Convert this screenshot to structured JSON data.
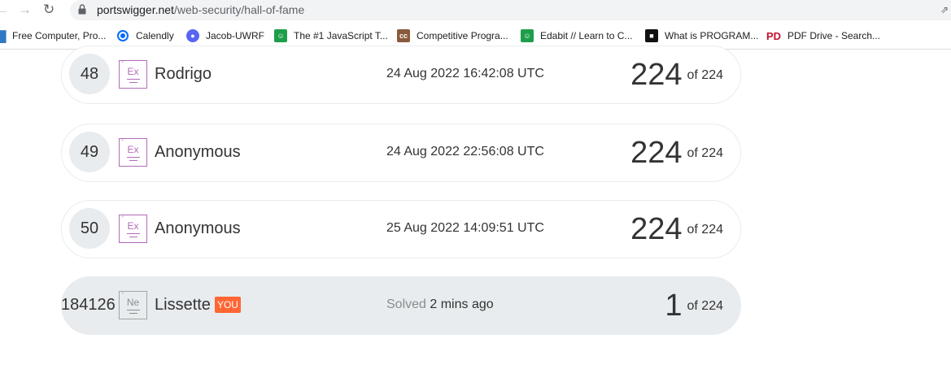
{
  "browser": {
    "url_host": "portswigger.net",
    "url_path": "/web-security/hall-of-fame",
    "bookmarks": [
      {
        "label": "Free Computer, Pro...",
        "icon": "microsoft-icon"
      },
      {
        "label": "Calendly",
        "icon": "calendly-icon"
      },
      {
        "label": "Jacob-UWRF",
        "icon": "discord-icon"
      },
      {
        "label": "The #1 JavaScript T...",
        "icon": "edabit-icon"
      },
      {
        "label": "Competitive Progra...",
        "icon": "cc-icon"
      },
      {
        "label": "Edabit // Learn to C...",
        "icon": "edabit-icon"
      },
      {
        "label": "What is PROGRAM...",
        "icon": "programiz-icon"
      },
      {
        "label": "PDF Drive - Search...",
        "icon": "pdfdrive-icon"
      }
    ]
  },
  "leaderboard": {
    "of_label": "of",
    "entries": [
      {
        "rank": "48",
        "level": "Ex",
        "name": "Rodrigo",
        "date": "24 Aug 2022 16:42:08 UTC",
        "solved": "224",
        "total": "224"
      },
      {
        "rank": "49",
        "level": "Ex",
        "name": "Anonymous",
        "date": "24 Aug 2022 22:56:08 UTC",
        "solved": "224",
        "total": "224"
      },
      {
        "rank": "50",
        "level": "Ex",
        "name": "Anonymous",
        "date": "25 Aug 2022 14:09:51 UTC",
        "solved": "224",
        "total": "224"
      }
    ],
    "current_user": {
      "rank": "184126",
      "level": "Ne",
      "name": "Lissette",
      "you_badge": "YOU",
      "solved_prefix": "Solved",
      "solved_time": "2 mins ago",
      "solved": "1",
      "total": "224"
    }
  },
  "colors": {
    "expert_badge": "#b36bb8",
    "novice_badge": "#a4a4a4",
    "you_badge": "#ff6633",
    "row_highlight": "#e8ecef"
  }
}
